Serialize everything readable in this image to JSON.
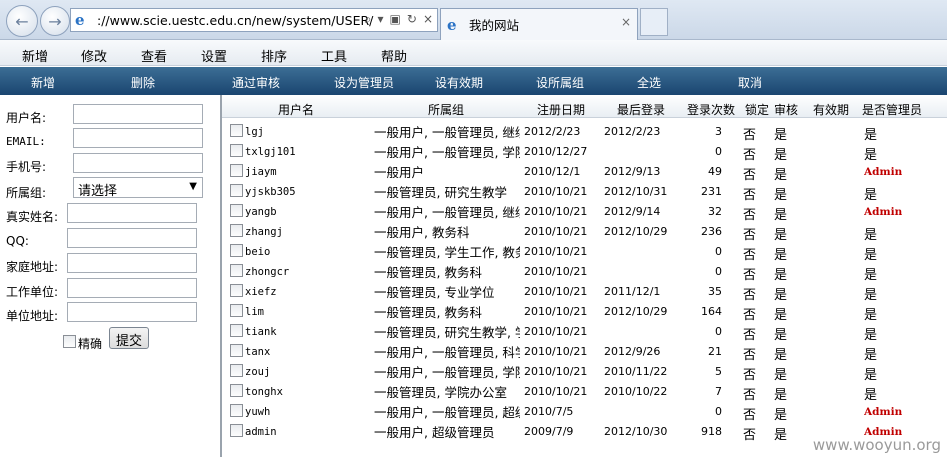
{
  "browser": {
    "url": "://www.scie.uestc.edu.cn/new/system/USER/",
    "tab_title": "我的网站",
    "tab_close": "×"
  },
  "menu": [
    "新增",
    "修改",
    "查看",
    "设置",
    "排序",
    "工具",
    "帮助"
  ],
  "toolbar": [
    "新增",
    "删除",
    "通过审核",
    "设为管理员",
    "设有效期",
    "设所属组",
    "全选",
    "取消"
  ],
  "form": {
    "username_label": "用户名:",
    "email_label": "EMAIL:",
    "phone_label": "手机号:",
    "group_label": "所属组:",
    "group_value": "请选择",
    "realname_label": "真实姓名:",
    "qq_label": "QQ:",
    "address_label": "家庭地址:",
    "company_label": "工作单位:",
    "company_address_label": "单位地址:",
    "exact_label": "精确",
    "submit_label": "提交"
  },
  "table": {
    "headers": [
      "用户名",
      "所属组",
      "注册日期",
      "最后登录",
      "登录次数",
      "锁定",
      "审核",
      "有效期",
      "是否管理员"
    ],
    "rows": [
      {
        "user": "lgj",
        "group": "一般用户, 一般管理员, 继续",
        "reg": "2012/2/23",
        "last": "2012/2/23",
        "count": "3",
        "locked": "否",
        "audited": "是",
        "admin": "是",
        "admin_red": false
      },
      {
        "user": "txlgj101",
        "group": "一般用户, 一般管理员, 学院",
        "reg": "2010/12/27",
        "last": "",
        "count": "0",
        "locked": "否",
        "audited": "是",
        "admin": "是",
        "admin_red": false
      },
      {
        "user": "jiaym",
        "group": "一般用户",
        "reg": "2010/12/1",
        "last": "2012/9/13",
        "count": "49",
        "locked": "否",
        "audited": "是",
        "admin": "Admin",
        "admin_red": true
      },
      {
        "user": "yjskb305",
        "group": "一般管理员, 研究生教学",
        "reg": "2010/10/21",
        "last": "2012/10/31",
        "count": "231",
        "locked": "否",
        "audited": "是",
        "admin": "是",
        "admin_red": false
      },
      {
        "user": "yangb",
        "group": "一般用户, 一般管理员, 继续",
        "reg": "2010/10/21",
        "last": "2012/9/14",
        "count": "32",
        "locked": "否",
        "audited": "是",
        "admin": "Admin",
        "admin_red": true
      },
      {
        "user": "zhangj",
        "group": "一般用户, 教务科",
        "reg": "2010/10/21",
        "last": "2012/10/29",
        "count": "236",
        "locked": "否",
        "audited": "是",
        "admin": "是",
        "admin_red": false
      },
      {
        "user": "beio",
        "group": "一般管理员, 学生工作, 教务",
        "reg": "2010/10/21",
        "last": "",
        "count": "0",
        "locked": "否",
        "audited": "是",
        "admin": "是",
        "admin_red": false
      },
      {
        "user": "zhongcr",
        "group": "一般管理员, 教务科",
        "reg": "2010/10/21",
        "last": "",
        "count": "0",
        "locked": "否",
        "audited": "是",
        "admin": "是",
        "admin_red": false
      },
      {
        "user": "xiefz",
        "group": "一般管理员, 专业学位",
        "reg": "2010/10/21",
        "last": "2011/12/1",
        "count": "35",
        "locked": "否",
        "audited": "是",
        "admin": "是",
        "admin_red": false
      },
      {
        "user": "lim",
        "group": "一般管理员, 教务科",
        "reg": "2010/10/21",
        "last": "2012/10/29",
        "count": "164",
        "locked": "否",
        "audited": "是",
        "admin": "是",
        "admin_red": false
      },
      {
        "user": "tiank",
        "group": "一般管理员, 研究生教学, 学",
        "reg": "2010/10/21",
        "last": "",
        "count": "0",
        "locked": "否",
        "audited": "是",
        "admin": "是",
        "admin_red": false
      },
      {
        "user": "tanx",
        "group": "一般用户, 一般管理员, 科学",
        "reg": "2010/10/21",
        "last": "2012/9/26",
        "count": "21",
        "locked": "否",
        "audited": "是",
        "admin": "是",
        "admin_red": false
      },
      {
        "user": "zouj",
        "group": "一般用户, 一般管理员, 学院",
        "reg": "2010/10/21",
        "last": "2010/11/22",
        "count": "5",
        "locked": "否",
        "audited": "是",
        "admin": "是",
        "admin_red": false
      },
      {
        "user": "tonghx",
        "group": "一般管理员, 学院办公室",
        "reg": "2010/10/21",
        "last": "2010/10/22",
        "count": "7",
        "locked": "否",
        "audited": "是",
        "admin": "是",
        "admin_red": false
      },
      {
        "user": "yuwh",
        "group": "一般用户, 一般管理员, 超级",
        "reg": "2010/7/5",
        "last": "",
        "count": "0",
        "locked": "否",
        "audited": "是",
        "admin": "Admin",
        "admin_red": true
      },
      {
        "user": "admin",
        "group": "一般用户, 超级管理员",
        "reg": "2009/7/9",
        "last": "2012/10/30",
        "count": "918",
        "locked": "否",
        "audited": "是",
        "admin": "Admin",
        "admin_red": true
      }
    ]
  },
  "watermark": "www.wooyun.org"
}
